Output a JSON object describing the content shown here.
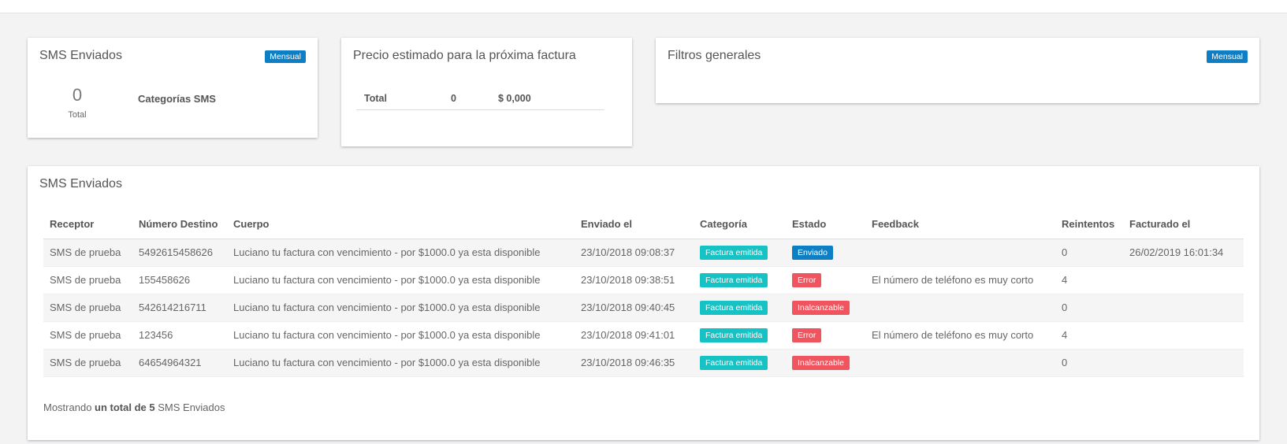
{
  "colors": {
    "background": "#f3f3f4",
    "badge_mensual": "#0e7fc4",
    "factura_emitida": "#17c2c4",
    "enviado": "#0e7fc4",
    "error": "#f0545e",
    "inalcanzable": "#f0545e"
  },
  "sms_card": {
    "title": "SMS Enviados",
    "badge": "Mensual",
    "total_value": "0",
    "total_label": "Total",
    "categories_label": "Categorías SMS"
  },
  "price_card": {
    "title": "Precio estimado para la próxima factura",
    "row_label": "Total",
    "row_count": "0",
    "row_price": "$ 0,000"
  },
  "filters_card": {
    "title": "Filtros generales",
    "badge": "Mensual"
  },
  "table_card": {
    "title": "SMS Enviados",
    "columns": [
      "Receptor",
      "Número Destino",
      "Cuerpo",
      "Enviado el",
      "Categoría",
      "Estado",
      "Feedback",
      "Reintentos",
      "Facturado el"
    ],
    "rows": [
      {
        "receptor": "SMS de prueba",
        "numero": "5492615458626",
        "cuerpo": "Luciano tu factura con vencimiento - por $1000.0 ya esta disponible",
        "enviado": "23/10/2018 09:08:37",
        "categoria": "Factura emitida",
        "estado": "Enviado",
        "estado_color": "#0e7fc4",
        "feedback": "",
        "reintentos": "0",
        "facturado": "26/02/2019 16:01:34"
      },
      {
        "receptor": "SMS de prueba",
        "numero": "155458626",
        "cuerpo": "Luciano tu factura con vencimiento - por $1000.0 ya esta disponible",
        "enviado": "23/10/2018 09:38:51",
        "categoria": "Factura emitida",
        "estado": "Error",
        "estado_color": "#f0545e",
        "feedback": "El número de teléfono es muy corto",
        "reintentos": "4",
        "facturado": ""
      },
      {
        "receptor": "SMS de prueba",
        "numero": "542614216711",
        "cuerpo": "Luciano tu factura con vencimiento - por $1000.0 ya esta disponible",
        "enviado": "23/10/2018 09:40:45",
        "categoria": "Factura emitida",
        "estado": "Inalcanzable",
        "estado_color": "#f0545e",
        "feedback": "",
        "reintentos": "0",
        "facturado": ""
      },
      {
        "receptor": "SMS de prueba",
        "numero": "123456",
        "cuerpo": "Luciano tu factura con vencimiento - por $1000.0 ya esta disponible",
        "enviado": "23/10/2018 09:41:01",
        "categoria": "Factura emitida",
        "estado": "Error",
        "estado_color": "#f0545e",
        "feedback": "El número de teléfono es muy corto",
        "reintentos": "4",
        "facturado": ""
      },
      {
        "receptor": "SMS de prueba",
        "numero": "64654964321",
        "cuerpo": "Luciano tu factura con vencimiento - por $1000.0 ya esta disponible",
        "enviado": "23/10/2018 09:46:35",
        "categoria": "Factura emitida",
        "estado": "Inalcanzable",
        "estado_color": "#f0545e",
        "feedback": "",
        "reintentos": "0",
        "facturado": ""
      }
    ],
    "footer_prefix": "Mostrando",
    "footer_bold": "un total de 5",
    "footer_suffix": "SMS Enviados"
  }
}
